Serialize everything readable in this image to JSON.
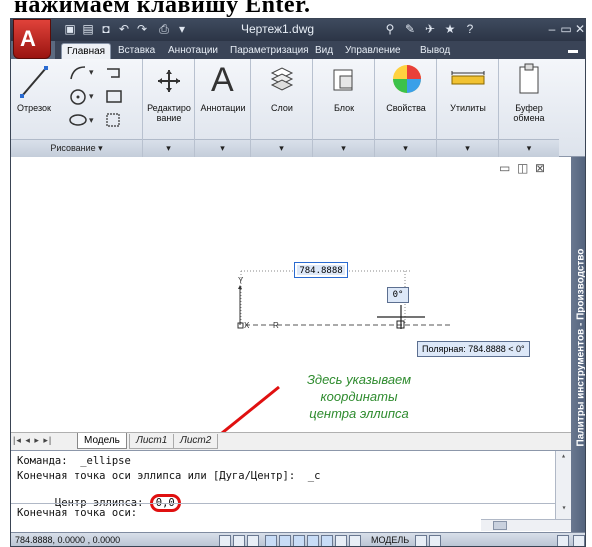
{
  "page_heading": "нажимаем клавишу Enter.",
  "titlebar": {
    "document_title": "Чертеж1.dwg",
    "app_letter": "A"
  },
  "ribbon_tabs": [
    "Главная",
    "Вставка",
    "Аннотации",
    "Параметризация",
    "Вид",
    "Управление",
    "Вывод"
  ],
  "ribbon": {
    "draw_line_label": "Отрезок",
    "modify_label": "Редактиро вание",
    "annotation_label": "Аннотации",
    "layers_label": "Слои",
    "block_label": "Блок",
    "properties_label": "Свойства",
    "utilities_label": "Утилиты",
    "clipboard_label": "Буфер обмена",
    "draw_panel_footer": "Рисование ▾"
  },
  "canvas": {
    "dynamic_input_value": "784.8888",
    "angle_value": "0°",
    "polar_tooltip": "Полярная: 784.8888 < 0°",
    "annotation_line1": "Здесь указываем",
    "annotation_line2": "координаты",
    "annotation_line3": "центра эллипса"
  },
  "right_palette_title": "Палитры инструментов - Производство",
  "layout_tabs": [
    "Модель",
    "Лист1",
    "Лист2"
  ],
  "command_line": {
    "line1": "Команда:  _ellipse",
    "line2": "Конечная точка оси эллипса или [Дуга/Центр]:  _c",
    "line3_prefix": "Центр эллипса: ",
    "line3_value": "0,0",
    "prompt": "Конечная точка оси:"
  },
  "statusbar": {
    "coordinates": "784.8888, 0.0000  , 0.0000",
    "model_label": "МОДЕЛЬ"
  },
  "colors": {
    "annotation_green": "#2e8b2e",
    "arrow_red": "#e01010",
    "titlebar_bg": "#2c3546"
  }
}
